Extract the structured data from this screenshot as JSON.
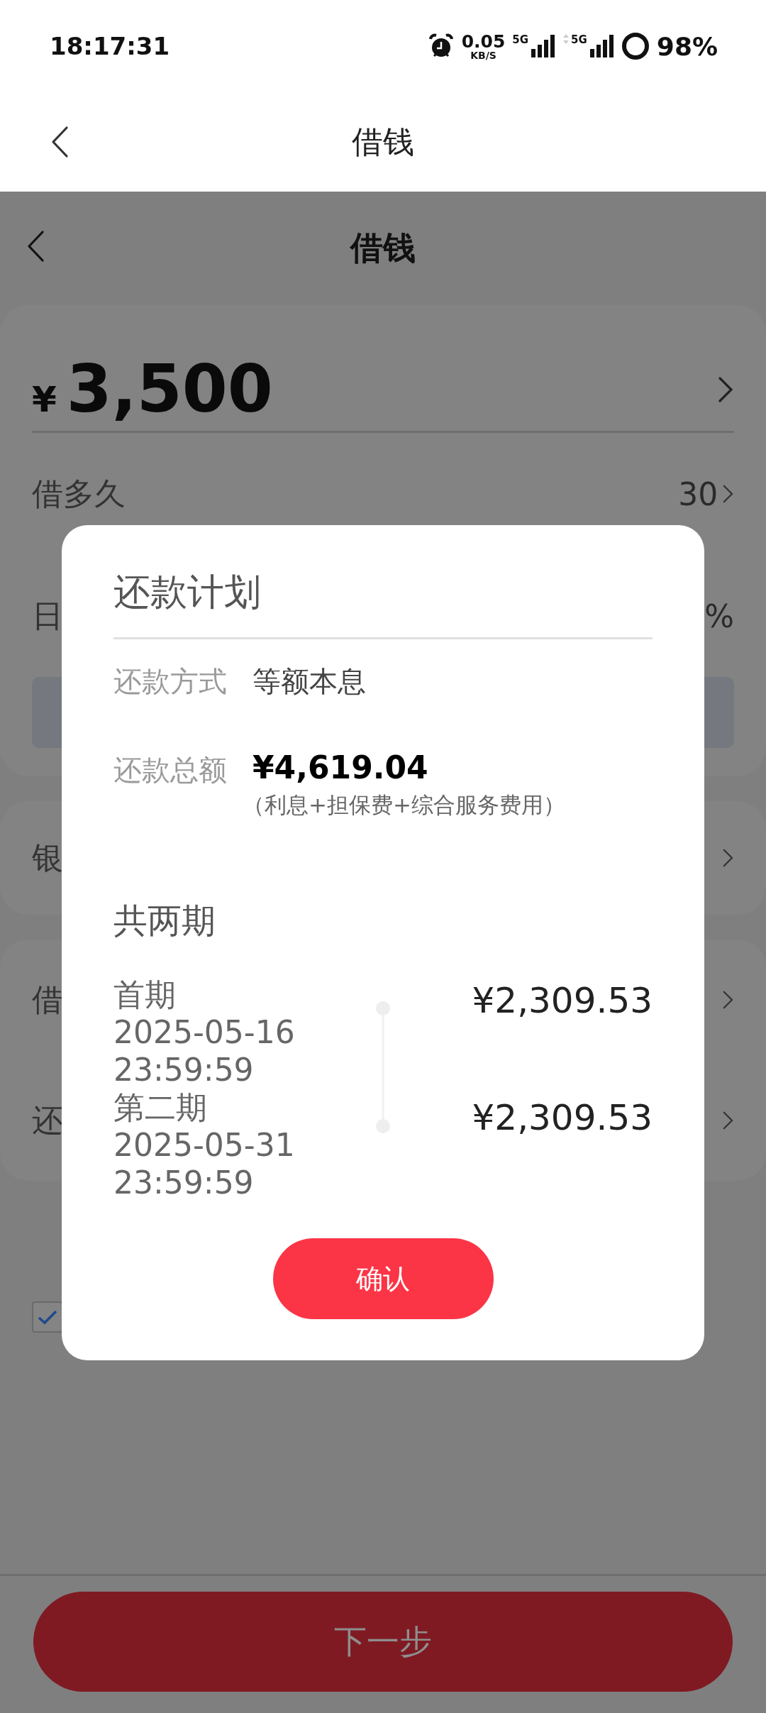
{
  "status_bar": {
    "time": "18:17:31",
    "net_speed": "0.05",
    "net_unit": "KB/S",
    "sims": [
      {
        "label": "5G",
        "data_arrows": false
      },
      {
        "label": "5G",
        "data_arrows": true
      }
    ],
    "battery": "98%"
  },
  "nav": {
    "title": "借钱"
  },
  "page": {
    "title": "借钱",
    "currency": "¥",
    "amount": "3,500",
    "rows": [
      {
        "kind": "value",
        "label": "借多久",
        "value": "30"
      },
      {
        "kind": "value",
        "label": "日",
        "value": "%"
      },
      {
        "kind": "bar"
      }
    ],
    "cards": [
      [
        {
          "label": "银"
        }
      ],
      [
        {
          "label": "借"
        },
        {
          "label": "还"
        }
      ]
    ],
    "agree_checked": true,
    "next_button": "下一步"
  },
  "dialog": {
    "title": "还款计划",
    "method_label": "还款方式",
    "method_value": "等额本息",
    "total_label": "还款总额",
    "total_value": "¥4,619.04",
    "total_note": "（利息+担保费+综合服务费用）",
    "periods_title": "共两期",
    "installments": [
      {
        "name": "首期",
        "date": "2025-05-16",
        "time": "23:59:59",
        "amount": "¥2,309.53"
      },
      {
        "name": "第二期",
        "date": "2025-05-31",
        "time": "23:59:59",
        "amount": "¥2,309.53"
      }
    ],
    "confirm": "确认"
  }
}
